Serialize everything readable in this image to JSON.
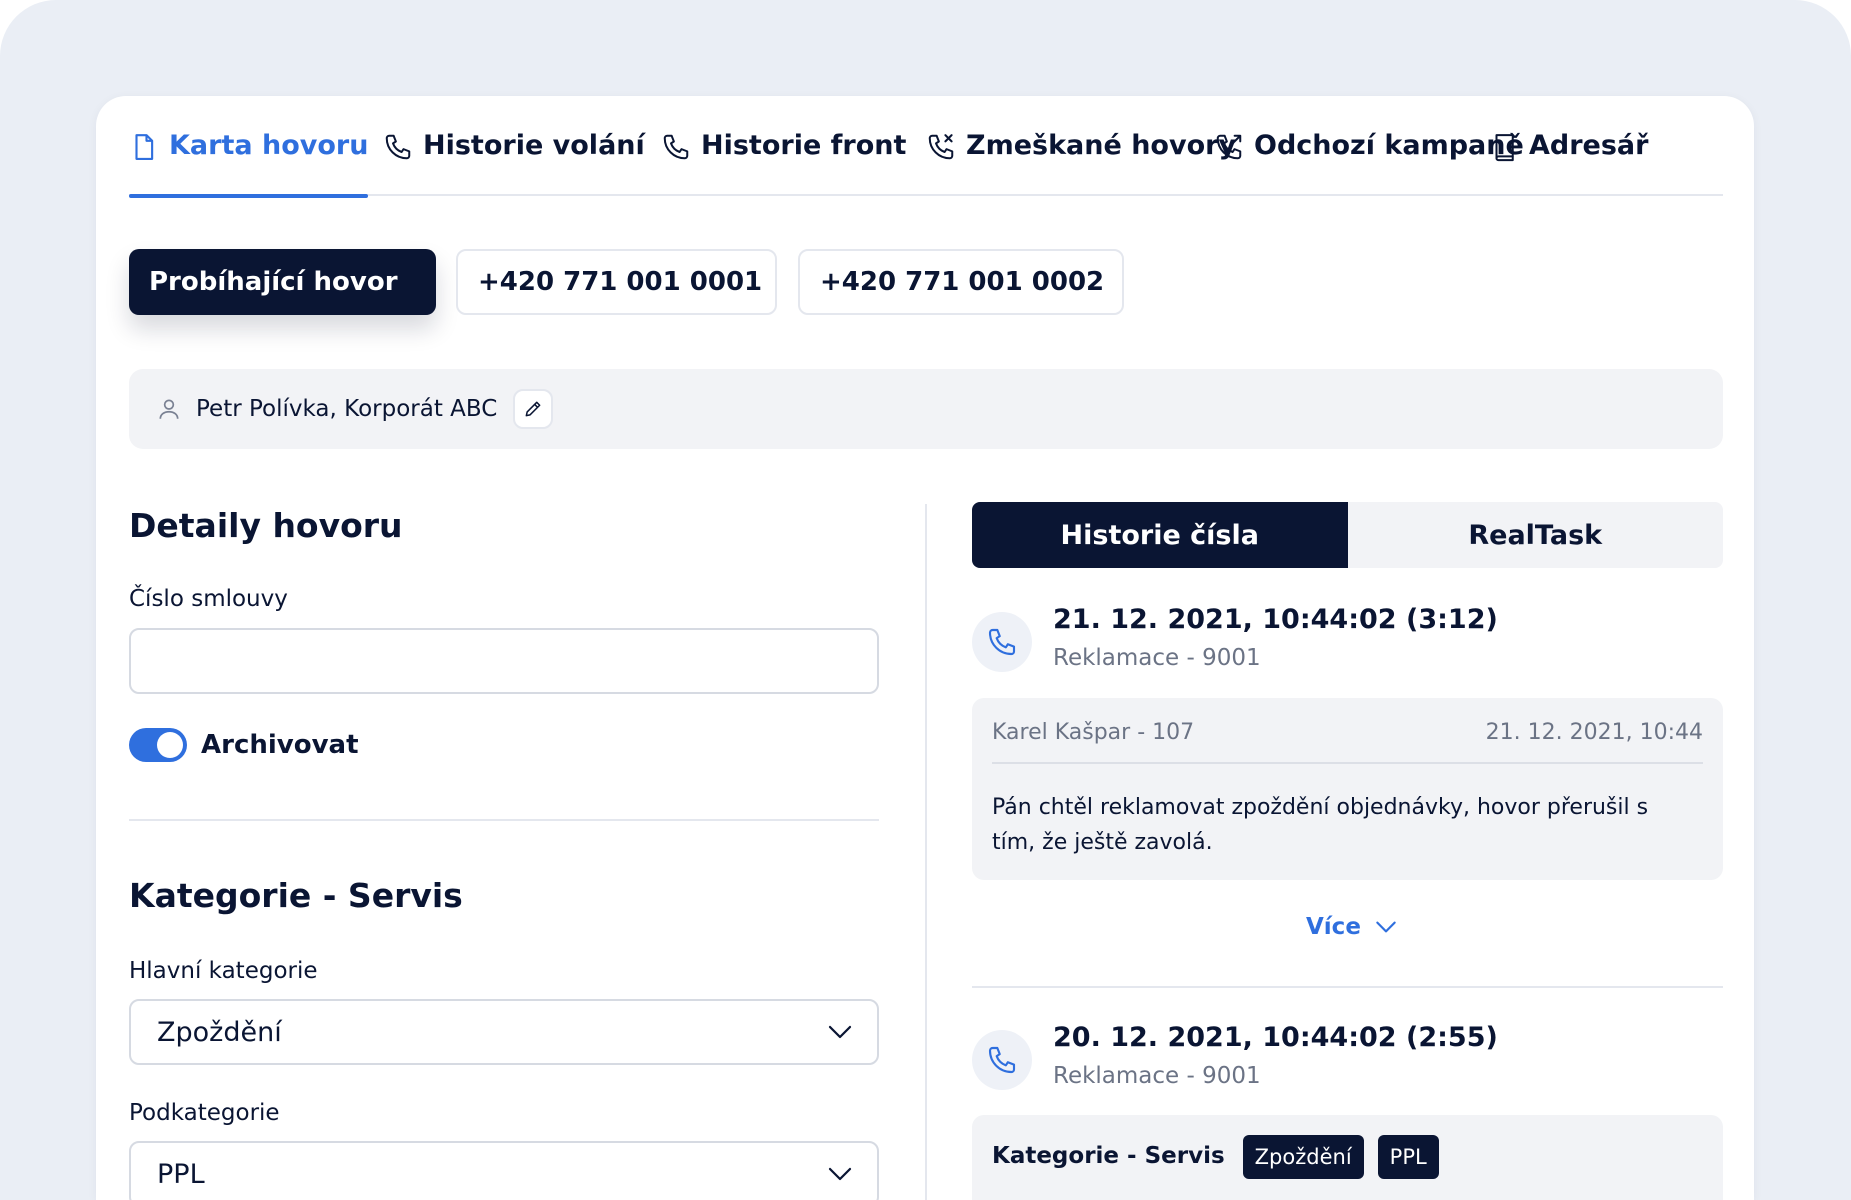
{
  "tabs": [
    {
      "label": "Karta hovoru",
      "icon": "document-icon",
      "active": true
    },
    {
      "label": "Historie volání",
      "icon": "phone-icon"
    },
    {
      "label": "Historie front",
      "icon": "phone-icon"
    },
    {
      "label": "Zmeškané hovory",
      "icon": "missed-call-icon"
    },
    {
      "label": "Odchozí kampaně",
      "icon": "outgoing-call-icon"
    },
    {
      "label": "Adresář",
      "icon": "book-icon"
    }
  ],
  "chips": [
    {
      "label": "Probíhající hovor",
      "active": true
    },
    {
      "label": "+420 771 001 0001"
    },
    {
      "label": "+420 771 001 0002"
    }
  ],
  "contact": {
    "name": "Petr Polívka, Korporát ABC"
  },
  "details": {
    "title": "Detaily hovoru",
    "contract_label": "Číslo smlouvy",
    "contract_value": "",
    "archive_label": "Archivovat",
    "archive_on": true
  },
  "category": {
    "title": "Kategorie - Servis",
    "main_label": "Hlavní kategorie",
    "main_value": "Zpoždění",
    "sub_label": "Podkategorie",
    "sub_value": "PPL"
  },
  "history": {
    "tabs": [
      {
        "label": "Historie čísla",
        "active": true
      },
      {
        "label": "RealTask"
      }
    ],
    "calls": [
      {
        "title": "21. 12. 2021, 10:44:02 (3:12)",
        "subtitle": "Reklamace - 9001",
        "note": {
          "author": "Karel Kašpar - 107",
          "time": "21. 12. 2021, 10:44",
          "text": "Pán chtěl reklamovat zpoždění objednávky, hovor přerušil s tím, že ještě zavolá."
        }
      },
      {
        "title": "20. 12. 2021, 10:44:02 (2:55)",
        "subtitle": "Reklamace - 9001",
        "category_label": "Kategorie - Servis",
        "badges": [
          "Zpoždění",
          "PPL"
        ]
      }
    ],
    "more_label": "Více"
  },
  "colors": {
    "accent": "#2f6fde",
    "dark": "#0a1533",
    "panel": "#f2f3f6",
    "muted": "#6b7385"
  }
}
